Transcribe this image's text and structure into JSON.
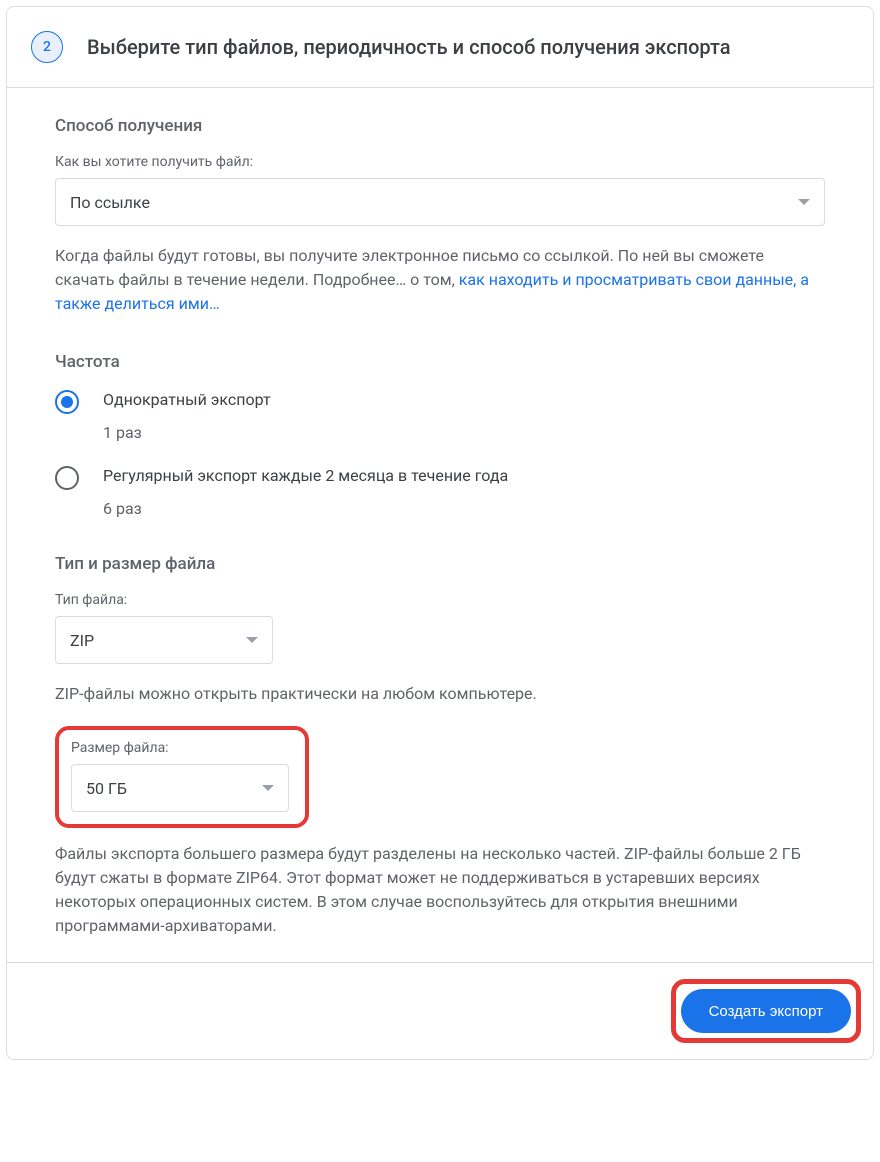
{
  "step": {
    "number": "2",
    "title": "Выберите тип файлов, периодичность и способ получения экспорта"
  },
  "delivery": {
    "section_title": "Способ получения",
    "field_label": "Как вы хотите получить файл:",
    "selected": "По ссылке",
    "description_prefix": "Когда файлы будут готовы, вы получите электронное письмо со ссылкой. По ней вы сможете скачать файлы в течение недели. Подробнее… о том, ",
    "link_text": "как находить и просматривать свои данные, а также делиться ими…"
  },
  "frequency": {
    "section_title": "Частота",
    "options": [
      {
        "label": "Однократный экспорт",
        "sub": "1 раз",
        "checked": true
      },
      {
        "label": "Регулярный экспорт каждые 2 месяца в течение года",
        "sub": "6 раз",
        "checked": false
      }
    ]
  },
  "file": {
    "section_title": "Тип и размер файла",
    "type_label": "Тип файла:",
    "type_selected": "ZIP",
    "type_description": "ZIP-файлы можно открыть практически на любом компьютере.",
    "size_label": "Размер файла:",
    "size_selected": "50 ГБ",
    "size_description": "Файлы экспорта большего размера будут разделены на несколько частей. ZIP-файлы больше 2 ГБ будут сжаты в формате ZIP64. Этот формат может не поддерживаться в устаревших версиях некоторых операционных систем. В этом случае воспользуйтесь для открытия внешними программами-архиваторами."
  },
  "actions": {
    "create_export": "Создать экспорт"
  }
}
